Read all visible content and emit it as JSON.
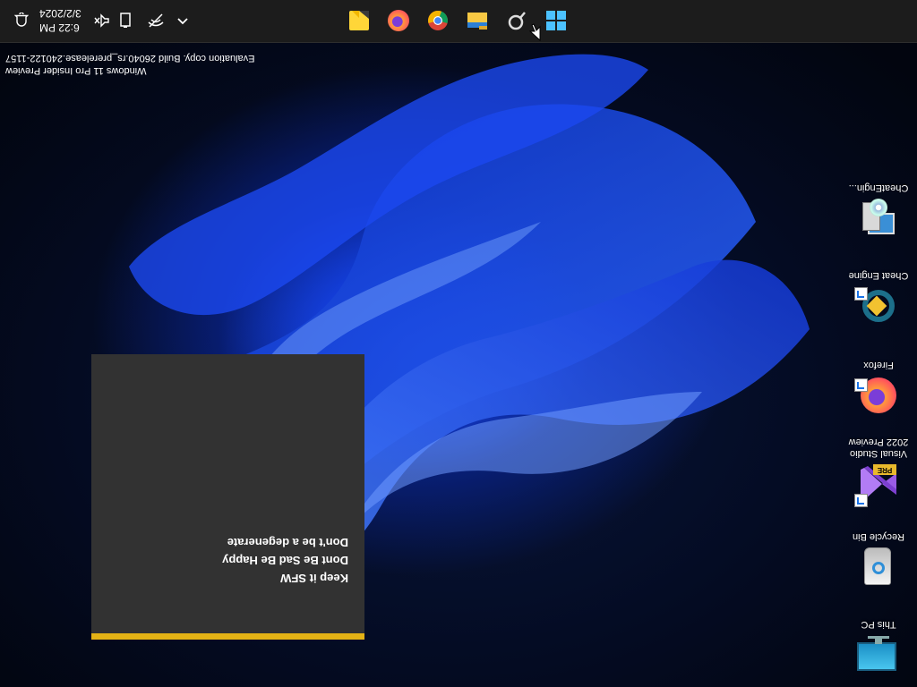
{
  "desktop": {
    "icons": [
      {
        "label": "This PC",
        "icon": "monitor-icon"
      },
      {
        "label": "Recycle Bin",
        "icon": "recycle-bin-icon"
      },
      {
        "label": "Visual Studio 2022 Preview",
        "icon": "visual-studio-preview-icon",
        "badge": "PRE"
      },
      {
        "label": "Firefox",
        "icon": "firefox-icon"
      },
      {
        "label": "Cheat Engine",
        "icon": "cheat-engine-icon"
      },
      {
        "label": "CheatEngin...",
        "icon": "cheat-engine-installer-icon"
      }
    ]
  },
  "notification": {
    "line1": "Keep it SFW",
    "line2": "Dont Be Sad Be Happy",
    "line3": "Don't be a degenerate",
    "accent_color": "#e4b215"
  },
  "watermark": {
    "line1": "Windows 11 Pro Insider Preview",
    "line2": "Evaluation copy. Build 26040.rs_prerelease.240122-1157"
  },
  "taskbar": {
    "apps": [
      "start-icon",
      "search-icon",
      "file-explorer-icon",
      "chrome-icon",
      "firefox-icon",
      "sticky-notes-icon"
    ],
    "tray": [
      "chevron-up-icon",
      "network-icon",
      "battery-icon",
      "volume-icon",
      "notification-bell-icon"
    ],
    "time": "6:22 PM",
    "date": "3/2/2024"
  },
  "orientation": "rotated 180 degrees"
}
